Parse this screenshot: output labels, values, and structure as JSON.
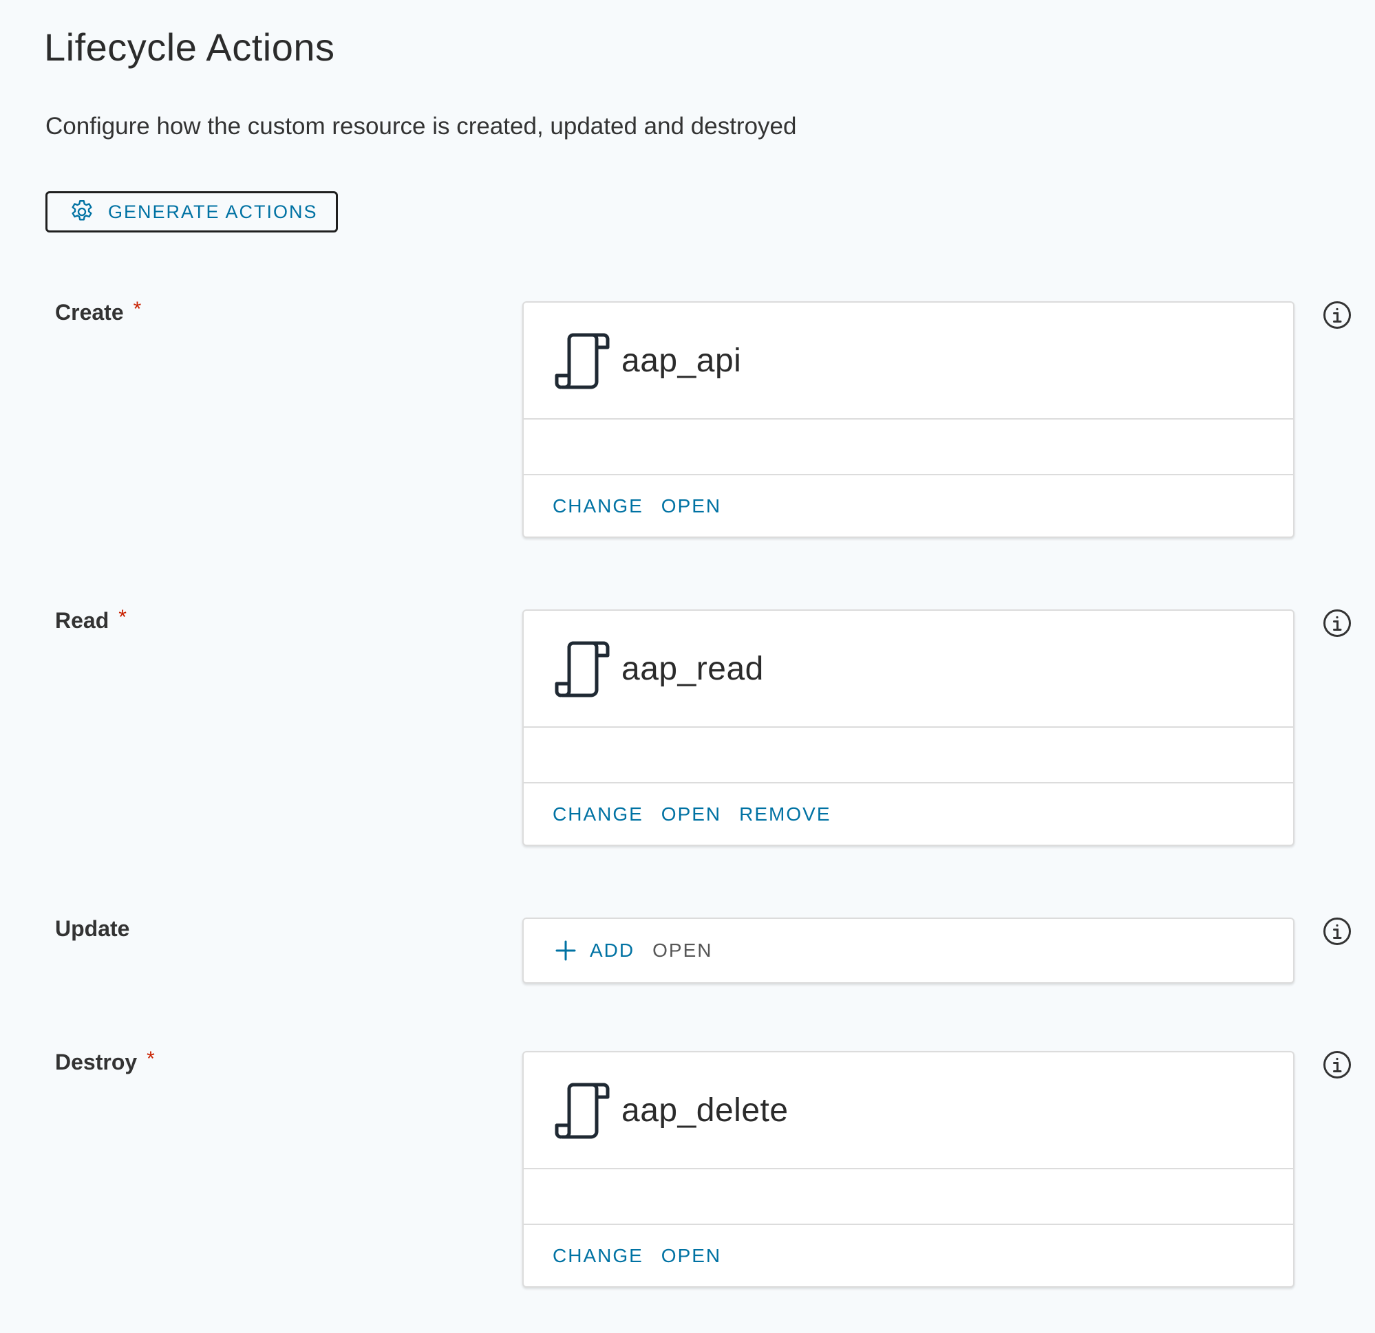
{
  "page": {
    "title": "Lifecycle Actions",
    "description": "Configure how the custom resource is created, updated and destroyed"
  },
  "toolbar": {
    "generate_label": "GENERATE ACTIONS",
    "generate_icon": "gear-icon"
  },
  "required_marker": "*",
  "colors": {
    "link": "#0072a3",
    "required": "#c92100",
    "background": "#f7fafc"
  },
  "actions": [
    {
      "label": "Create",
      "required": true,
      "action_name": "aap_api",
      "icon": "script-icon",
      "links": [
        "CHANGE",
        "OPEN"
      ]
    },
    {
      "label": "Read",
      "required": true,
      "action_name": "aap_read",
      "icon": "script-icon",
      "links": [
        "CHANGE",
        "OPEN",
        "REMOVE"
      ]
    },
    {
      "label": "Update",
      "required": false,
      "action_name": "",
      "icon": "plus-icon",
      "links": [
        "ADD",
        "OPEN"
      ]
    },
    {
      "label": "Destroy",
      "required": true,
      "action_name": "aap_delete",
      "icon": "script-icon",
      "links": [
        "CHANGE",
        "OPEN"
      ]
    }
  ]
}
